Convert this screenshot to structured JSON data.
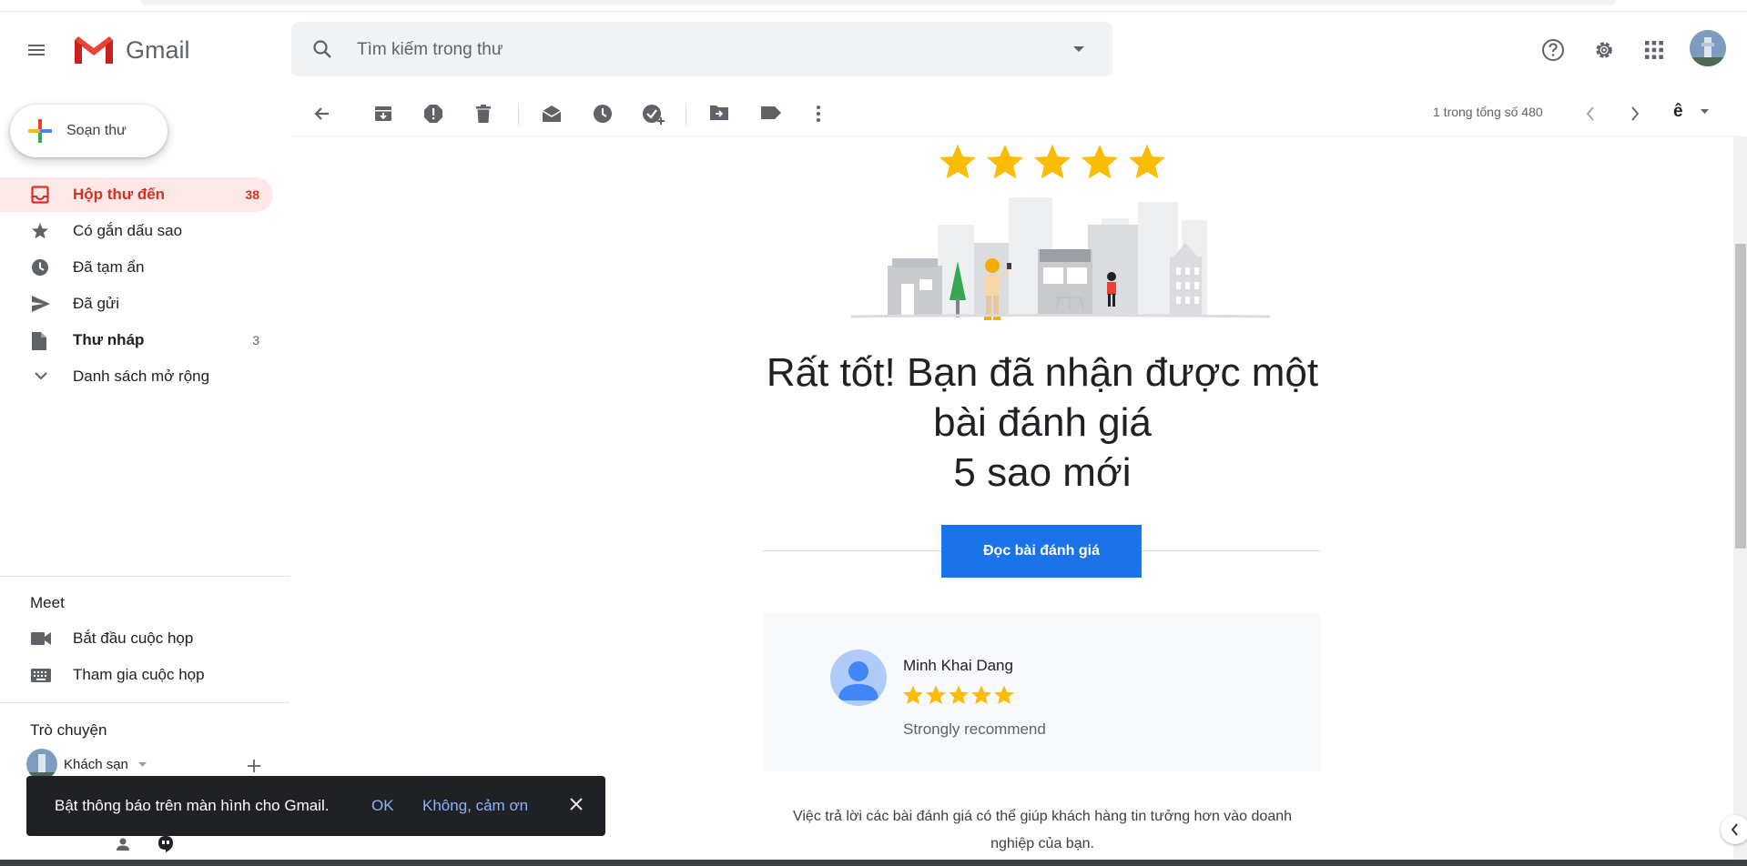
{
  "app": {
    "name": "Gmail",
    "colors": {
      "accent": "#1a73e8",
      "inbox_active": "#d93025",
      "inbox_active_bg": "#fce8e6",
      "star": "#fbbc04",
      "snackbar_bg": "#202124"
    }
  },
  "header": {
    "search_placeholder": "Tìm kiếm trong thư",
    "icons": [
      "menu-icon",
      "search-icon",
      "search-options-icon",
      "help-icon",
      "settings-icon",
      "apps-icon",
      "account-avatar"
    ]
  },
  "sidebar": {
    "compose_label": "Soạn thư",
    "items": [
      {
        "label": "Hộp thư đến",
        "count": "38",
        "icon": "inbox-icon",
        "active": true
      },
      {
        "label": "Có gắn dấu sao",
        "count": "",
        "icon": "star-icon"
      },
      {
        "label": "Đã tạm ẩn",
        "count": "",
        "icon": "clock-icon"
      },
      {
        "label": "Đã gửi",
        "count": "",
        "icon": "send-icon"
      },
      {
        "label": "Thư nháp",
        "count": "3",
        "icon": "draft-icon",
        "bold": true
      },
      {
        "label": "Danh sách mở rộng",
        "count": "",
        "icon": "chevron-down-icon"
      }
    ],
    "meet": {
      "title": "Meet",
      "items": [
        {
          "label": "Bắt đầu cuộc họp",
          "icon": "video-icon"
        },
        {
          "label": "Tham gia cuộc họp",
          "icon": "keyboard-icon"
        }
      ]
    },
    "chat": {
      "title": "Trò chuyện",
      "contact": "Khách sạn"
    }
  },
  "toolbar": {
    "pager_text": "1 trong tổng số 480",
    "input_tool": "ê",
    "icons": [
      "back-arrow-icon",
      "archive-icon",
      "report-spam-icon",
      "delete-icon",
      "mark-unread-icon",
      "snooze-icon",
      "add-task-icon",
      "move-to-icon",
      "label-icon",
      "more-vert-icon",
      "prev-icon",
      "next-icon"
    ]
  },
  "email": {
    "star_rating": 5,
    "headline_line1": "Rất tốt! Bạn đã nhận được một",
    "headline_line2": "bài đánh giá",
    "headline_line3": "5 sao mới",
    "cta_label": "Đọc bài đánh giá",
    "review": {
      "reviewer_name": "Minh Khai Dang",
      "stars": 5,
      "text": "Strongly recommend"
    },
    "footer_line1": "Việc trả lời các bài đánh giá có thể giúp khách hàng tin tưởng hơn vào doanh",
    "footer_line2": "nghiệp của bạn."
  },
  "snackbar": {
    "message": "Bật thông báo trên màn hình cho Gmail.",
    "ok_label": "OK",
    "decline_label": "Không, cảm ơn"
  }
}
